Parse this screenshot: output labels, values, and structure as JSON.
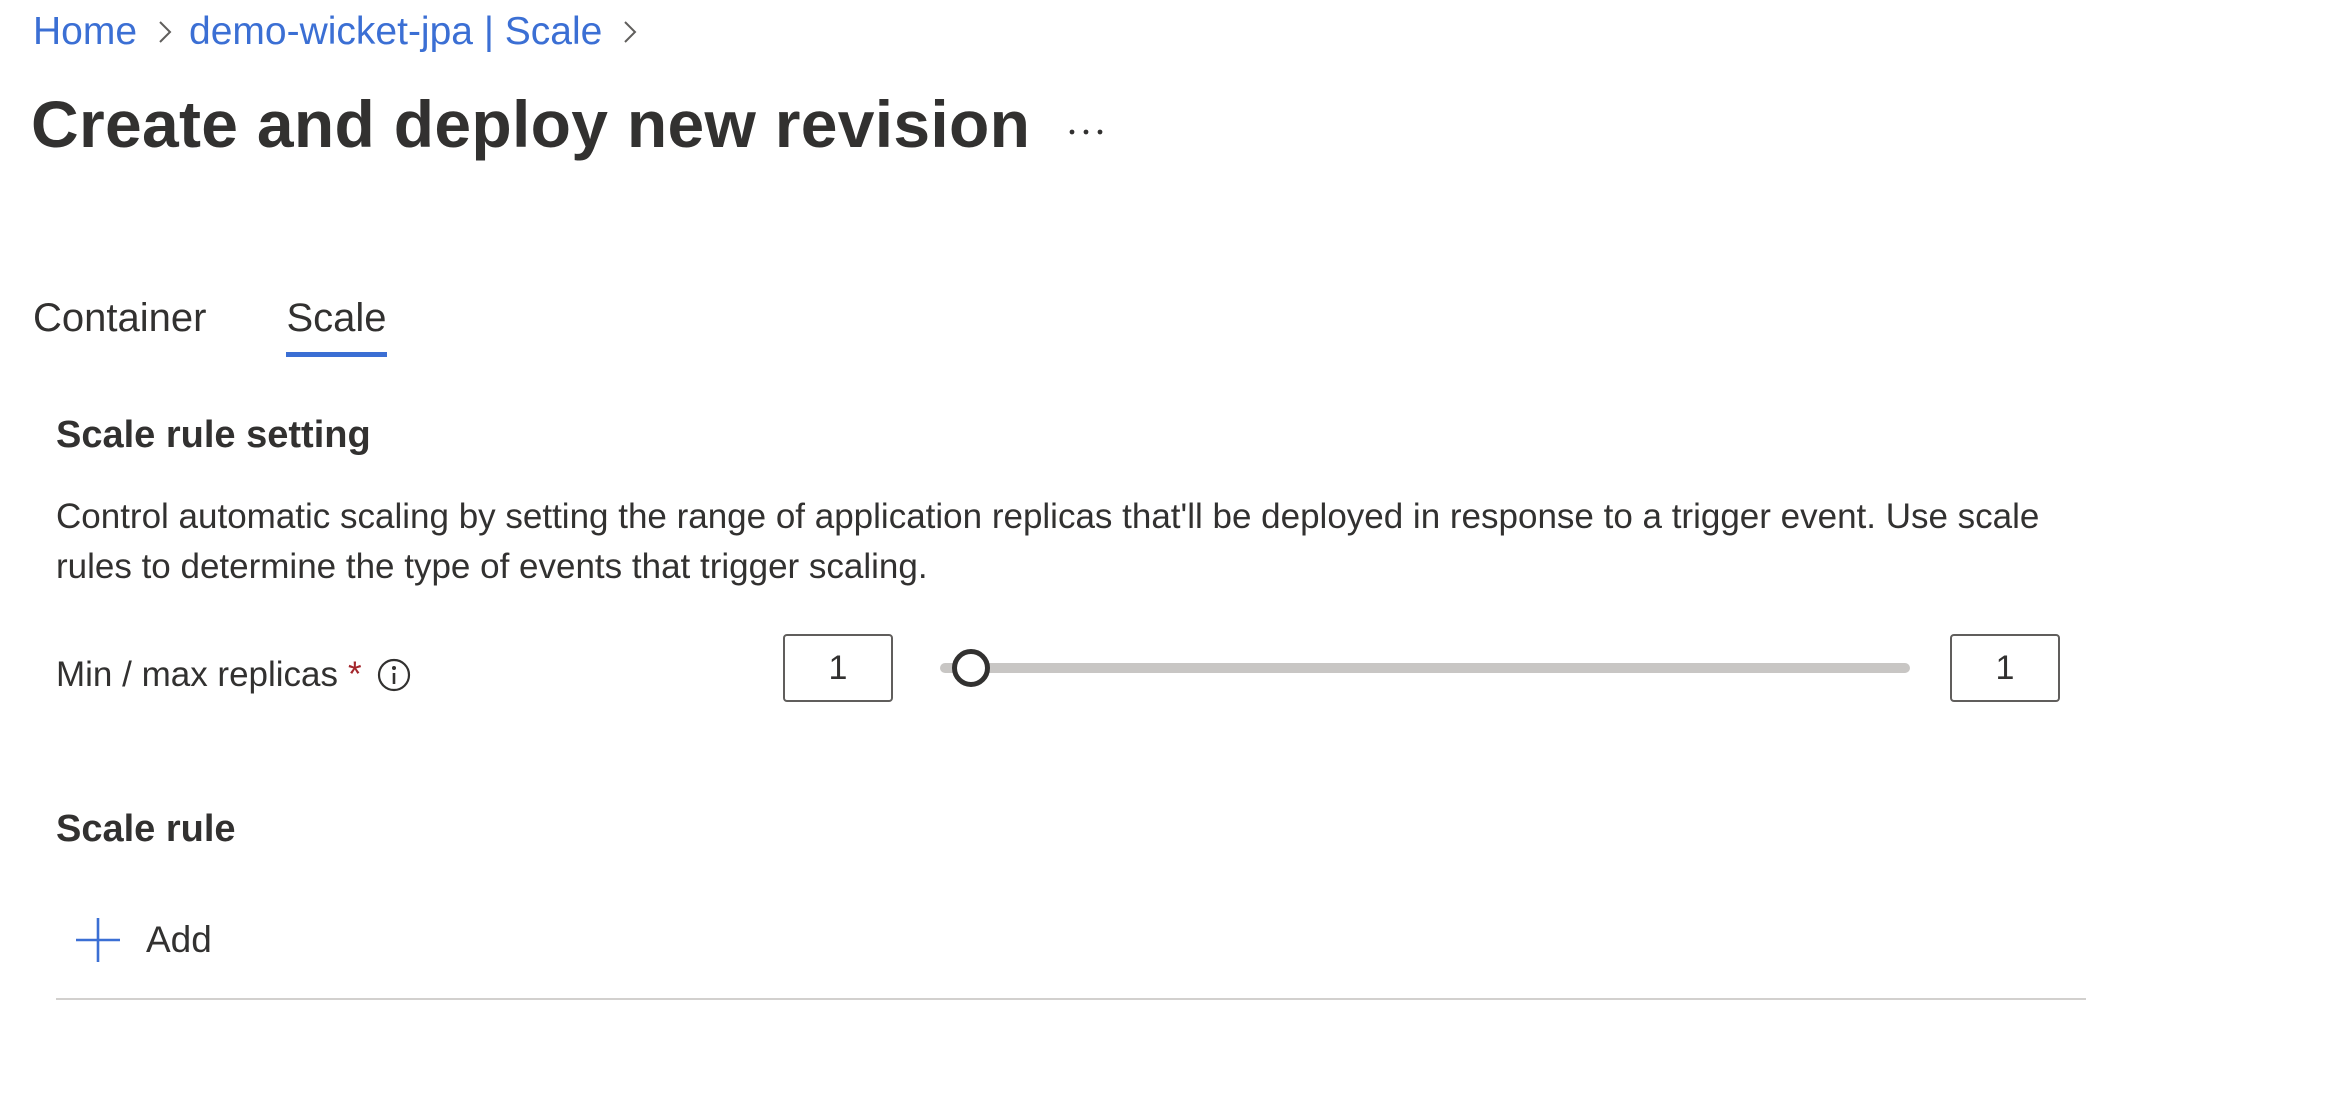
{
  "breadcrumb": {
    "items": [
      "Home",
      "demo-wicket-jpa | Scale"
    ]
  },
  "page": {
    "title": "Create and deploy new revision",
    "more_label": "..."
  },
  "tabs": [
    {
      "label": "Container",
      "active": false
    },
    {
      "label": "Scale",
      "active": true
    }
  ],
  "scale_setting": {
    "heading": "Scale rule setting",
    "description": "Control automatic scaling by setting the range of application replicas that'll be deployed in response to a trigger event. Use scale rules to determine the type of events that trigger scaling.",
    "replicas_label": "Min / max replicas",
    "required_mark": "*",
    "min_value": "1",
    "max_value": "1",
    "slider_position": 0
  },
  "scale_rule": {
    "heading": "Scale rule",
    "add_label": "Add"
  },
  "colors": {
    "link": "#3b6fd4",
    "accent": "#3b6fd4",
    "required": "#a4262c"
  },
  "icons": {
    "breadcrumb_separator": "chevron-right-icon",
    "more": "more-horizontal-icon",
    "info": "info-icon",
    "add": "plus-icon"
  }
}
